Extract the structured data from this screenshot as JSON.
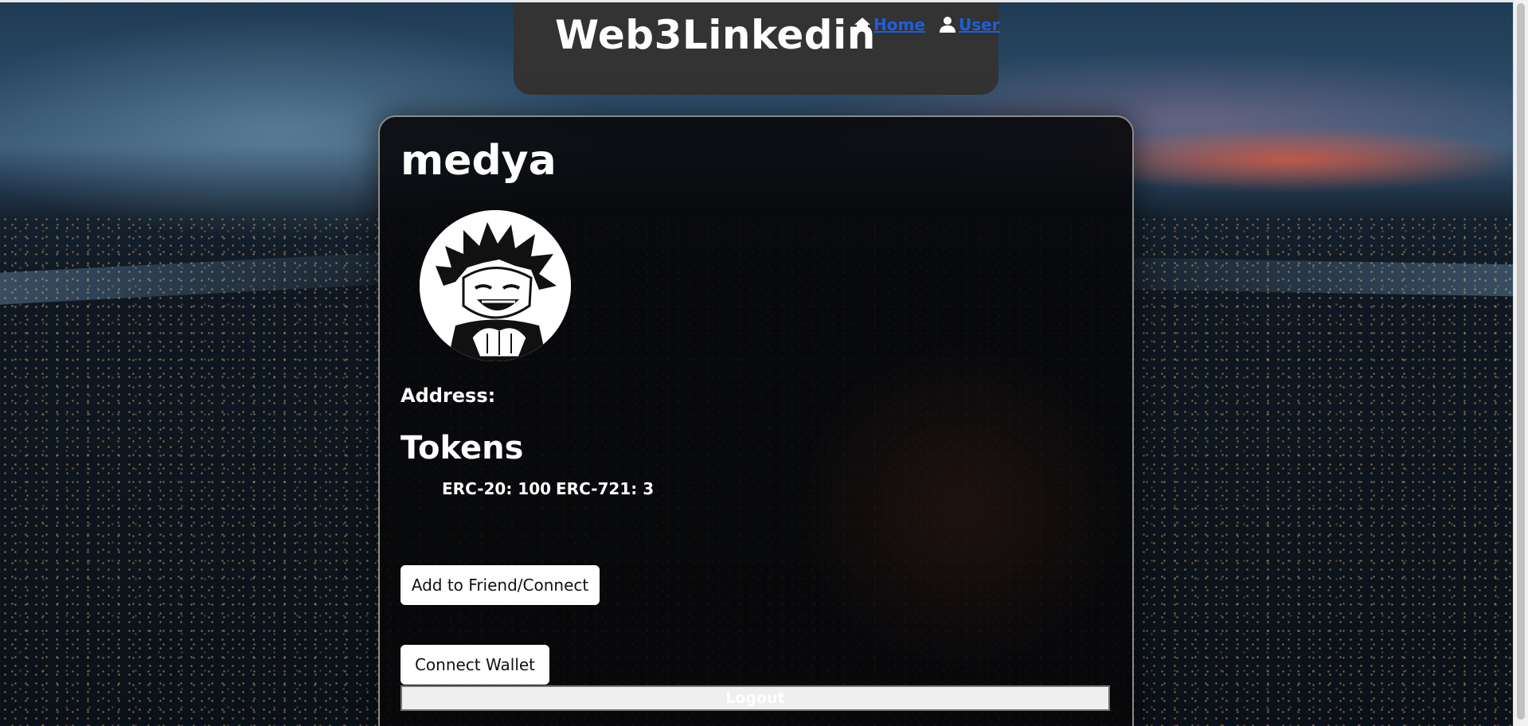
{
  "header": {
    "brand": "Web3Linkedin",
    "nav": {
      "home_label": "Home",
      "user_label": "User",
      "link_color": "#1a5fe0"
    }
  },
  "profile": {
    "username": "medya",
    "address_label": "Address:",
    "address_value": "",
    "tokens_title": "Tokens",
    "tokens": {
      "erc20": "ERC-20: 100",
      "erc721": "ERC-721: 3"
    }
  },
  "actions": {
    "add_friend_label": "Add to Friend/Connect",
    "connect_wallet_label": "Connect Wallet",
    "logout_label": "Logout"
  },
  "icons": {
    "home": "home-icon",
    "user": "user-icon",
    "avatar": "avatar"
  }
}
